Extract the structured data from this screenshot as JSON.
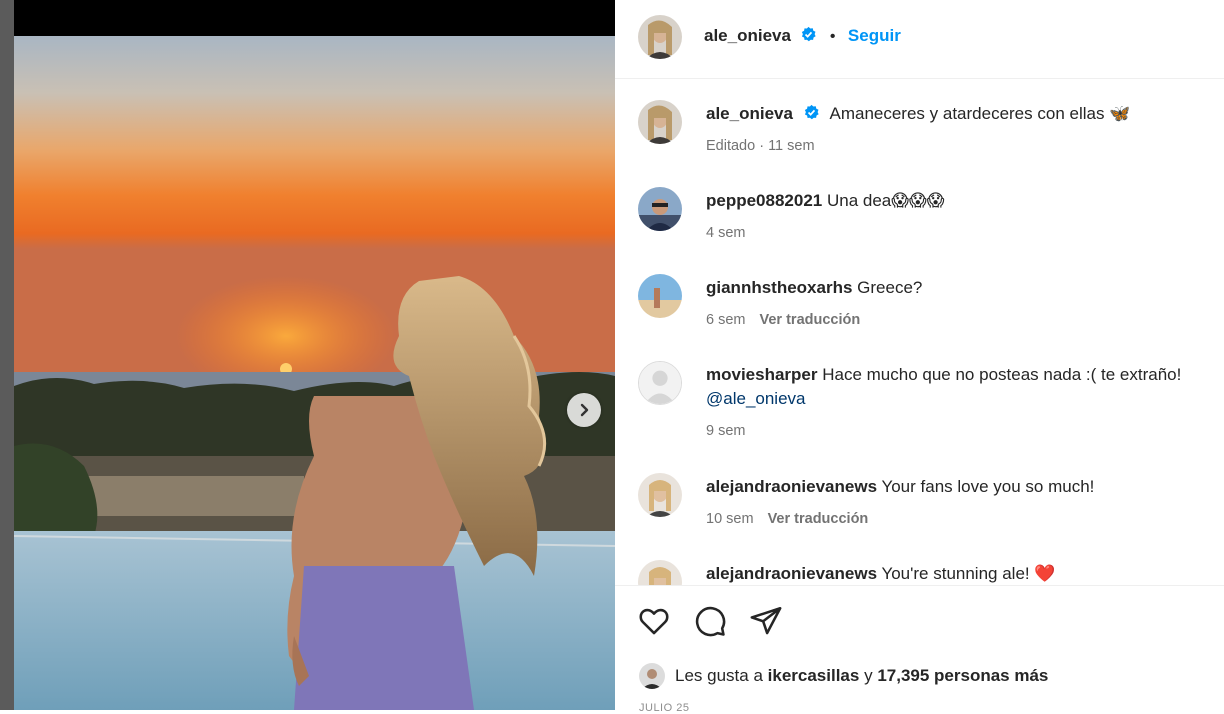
{
  "header": {
    "username": "ale_onieva",
    "separator": "•",
    "follow_label": "Seguir"
  },
  "caption": {
    "username": "ale_onieva",
    "text": "Amaneceres y atardeceres con ellas",
    "emoji": "🦋",
    "meta": "Editado · 11 sem"
  },
  "comments": [
    {
      "username": "peppe0882021",
      "text": "Una dea😱😱😱",
      "time": "4 sem",
      "translate": ""
    },
    {
      "username": "giannhstheoxarhs",
      "text": "Greece?",
      "time": "6 sem",
      "translate": "Ver traducción"
    },
    {
      "username": "moviesharper",
      "text": "Hace mucho que no posteas nada :( te extraño!",
      "mention": "@ale_onieva",
      "time": "9 sem",
      "translate": ""
    },
    {
      "username": "alejandraonievanews",
      "text": "Your fans love you so much!",
      "time": "10 sem",
      "translate": "Ver traducción"
    },
    {
      "username": "alejandraonievanews",
      "text": "You're stunning ale!",
      "emoji": "❤️",
      "time": "",
      "translate": ""
    }
  ],
  "likes": {
    "prefix": "Les gusta a",
    "user": "ikercasillas",
    "middle": "y",
    "count": "17,395 personas más"
  },
  "date": "JULIO 25",
  "icons": [
    "verified-badge-icon",
    "chevron-right-icon",
    "heart-icon",
    "comment-icon",
    "share-icon"
  ],
  "colors": {
    "accent": "#0095f6",
    "text": "#262626",
    "muted": "#737373"
  }
}
